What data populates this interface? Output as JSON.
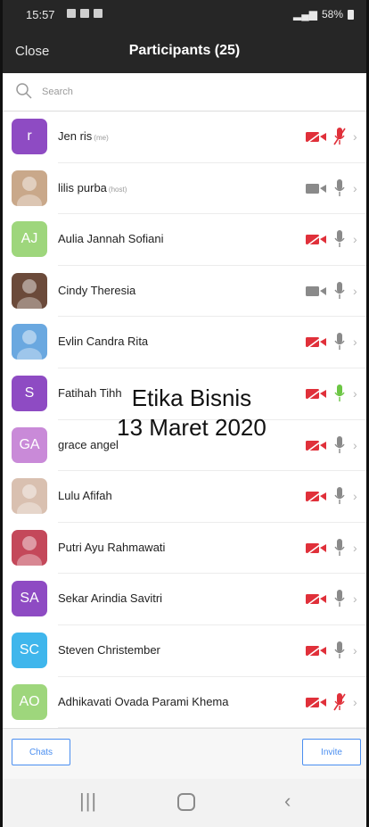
{
  "status_bar": {
    "time": "15:57",
    "battery": "58%"
  },
  "header": {
    "close_label": "Close",
    "title": "Participants (25)"
  },
  "search": {
    "placeholder": "Search"
  },
  "participants": [
    {
      "name": "Jen ris",
      "tag": "(me)",
      "initials": "r",
      "avatar_color": "#8e4bc3",
      "video": "off",
      "mic": "muted"
    },
    {
      "name": "lilis purba",
      "tag": "(host)",
      "initials": "",
      "avatar_color": "#c9a88a",
      "video": "on",
      "mic": "on"
    },
    {
      "name": "Aulia Jannah Sofiani",
      "tag": "",
      "initials": "AJ",
      "avatar_color": "#9ed67c",
      "video": "off",
      "mic": "on"
    },
    {
      "name": "Cindy Theresia",
      "tag": "",
      "initials": "",
      "avatar_color": "#6b4a3a",
      "video": "on",
      "mic": "on"
    },
    {
      "name": "Evlin Candra Rita",
      "tag": "",
      "initials": "",
      "avatar_color": "#6aa8e0",
      "video": "off",
      "mic": "on"
    },
    {
      "name": "Fatihah Tihh",
      "tag": "",
      "initials": "S",
      "avatar_color": "#8e4bc3",
      "video": "off",
      "mic": "speaking"
    },
    {
      "name": "grace angel",
      "tag": "",
      "initials": "GA",
      "avatar_color": "#c98ad8",
      "video": "off",
      "mic": "on"
    },
    {
      "name": "Lulu Afifah",
      "tag": "",
      "initials": "",
      "avatar_color": "#d9c0b0",
      "video": "off",
      "mic": "on"
    },
    {
      "name": "Putri Ayu Rahmawati",
      "tag": "",
      "initials": "",
      "avatar_color": "#c4485a",
      "video": "off",
      "mic": "on"
    },
    {
      "name": "Sekar Arindia Savitri",
      "tag": "",
      "initials": "SA",
      "avatar_color": "#8e4bc3",
      "video": "off",
      "mic": "on"
    },
    {
      "name": "Steven Christember",
      "tag": "",
      "initials": "SC",
      "avatar_color": "#3fb6ec",
      "video": "off",
      "mic": "on"
    },
    {
      "name": "Adhikavati Ovada Parami Khema",
      "tag": "",
      "initials": "AO",
      "avatar_color": "#9ed67c",
      "video": "off",
      "mic": "muted"
    }
  ],
  "overlay": {
    "line1": "Etika Bisnis",
    "line2": "13 Maret 2020"
  },
  "bottom": {
    "chats_label": "Chats",
    "invite_label": "Invite"
  },
  "colors": {
    "header_bg": "#262626",
    "accent": "#4a8ef0",
    "muted_red": "#e0303a",
    "speaking_green": "#6cc644"
  }
}
